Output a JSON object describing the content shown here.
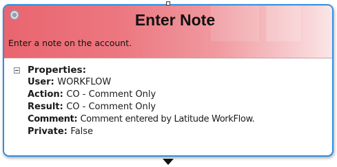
{
  "node": {
    "title": "Enter Note",
    "subtitle": "Enter a note on the account.",
    "icon": "gear-icon"
  },
  "properties": {
    "heading": "Properties:",
    "toggle_state": "expanded",
    "rows": [
      {
        "key": "User:",
        "value": "WORKFLOW"
      },
      {
        "key": "Action:",
        "value": "CO - Comment Only"
      },
      {
        "key": "Result:",
        "value": "CO - Comment Only"
      },
      {
        "key": "Comment:",
        "value": "Comment entered by Latitude WorkFlow."
      },
      {
        "key": "Private:",
        "value": "False"
      }
    ]
  },
  "colors": {
    "header_start": "#e9656f",
    "header_end": "#fbe6e7",
    "border": "#2d8ee6"
  }
}
